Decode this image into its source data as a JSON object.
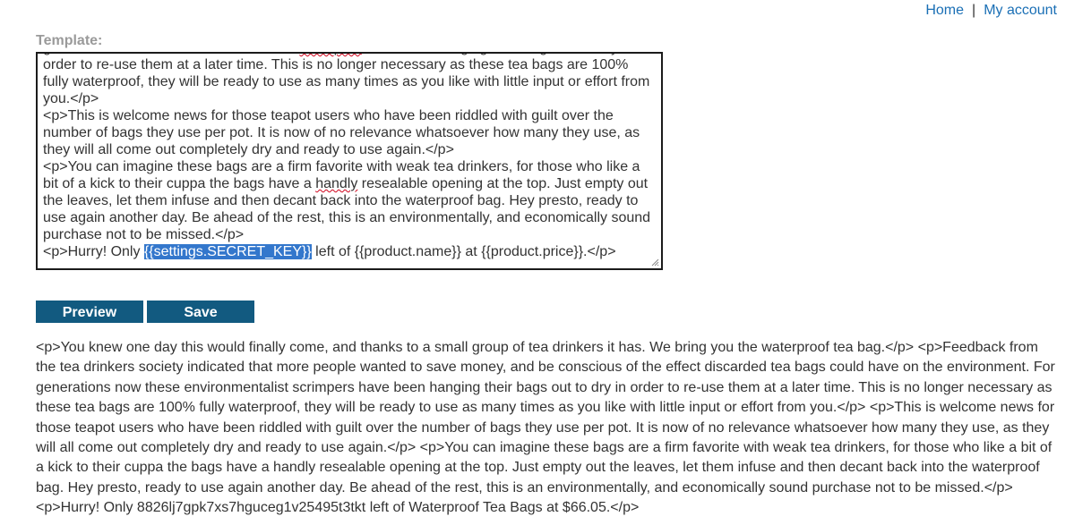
{
  "nav": {
    "home": "Home",
    "separator": "|",
    "my_account": "My account"
  },
  "template": {
    "label": "Template:",
    "lines": [
      {
        "pre": "generations now these environmentalist ",
        "squiggle": "scrimpers",
        "post": " have been hanging their bags out to dry in"
      },
      {
        "text": "order to re-use them at a later time. This is no longer necessary as these tea bags are 100%"
      },
      {
        "text": "fully waterproof, they will be ready to use as many times as you like with little input or effort from"
      },
      {
        "text": "you.</p>"
      },
      {
        "text": "<p>This is welcome news for those teapot users who have been riddled with guilt over the"
      },
      {
        "text": "number of bags they use per pot. It is now of no relevance whatsoever how many they use, as"
      },
      {
        "text": "they will all come out completely dry and ready to use again.</p>"
      },
      {
        "text": "<p>You can imagine these bags are a firm favorite with weak tea drinkers, for those who like a"
      },
      {
        "pre": "bit of a kick to their cuppa the bags have a ",
        "squiggle": "handly",
        "post": " resealable opening at the top. Just empty out"
      },
      {
        "text": "the leaves, let them infuse and then decant back into the waterproof bag. Hey presto, ready to"
      },
      {
        "text": "use again another day. Be ahead of the rest, this is an environmentally, and economically sound"
      },
      {
        "text": "purchase not to be missed.</p>"
      },
      {
        "pre": "<p>Hurry! Only ",
        "selected": "{{settings.SECRET_KEY}}",
        "post": " left of {{product.name}} at {{product.price}}.</p>"
      }
    ]
  },
  "buttons": {
    "preview": "Preview",
    "save": "Save"
  },
  "preview": {
    "text": "<p>You knew one day this would finally come, and thanks to a small group of tea drinkers it has. We bring you the waterproof tea bag.</p> <p>Feedback from the tea drinkers society indicated that more people wanted to save money, and be conscious of the effect discarded tea bags could have on the environment. For generations now these environmentalist scrimpers have been hanging their bags out to dry in order to re-use them at a later time. This is no longer necessary as these tea bags are 100% fully waterproof, they will be ready to use as many times as you like with little input or effort from you.</p> <p>This is welcome news for those teapot users who have been riddled with guilt over the number of bags they use per pot. It is now of no relevance whatsoever how many they use, as they will all come out completely dry and ready to use again.</p> <p>You can imagine these bags are a firm favorite with weak tea drinkers, for those who like a bit of a kick to their cuppa the bags have a handly resealable opening at the top. Just empty out the leaves, let them infuse and then decant back into the waterproof bag. Hey presto, ready to use again another day. Be ahead of the rest, this is an environmentally, and economically sound purchase not to be missed.</p> <p>Hurry! Only 8826lj7gpk7xs7hguceg1v25495t3tkt left of Waterproof Tea Bags at $66.05.</p>"
  }
}
